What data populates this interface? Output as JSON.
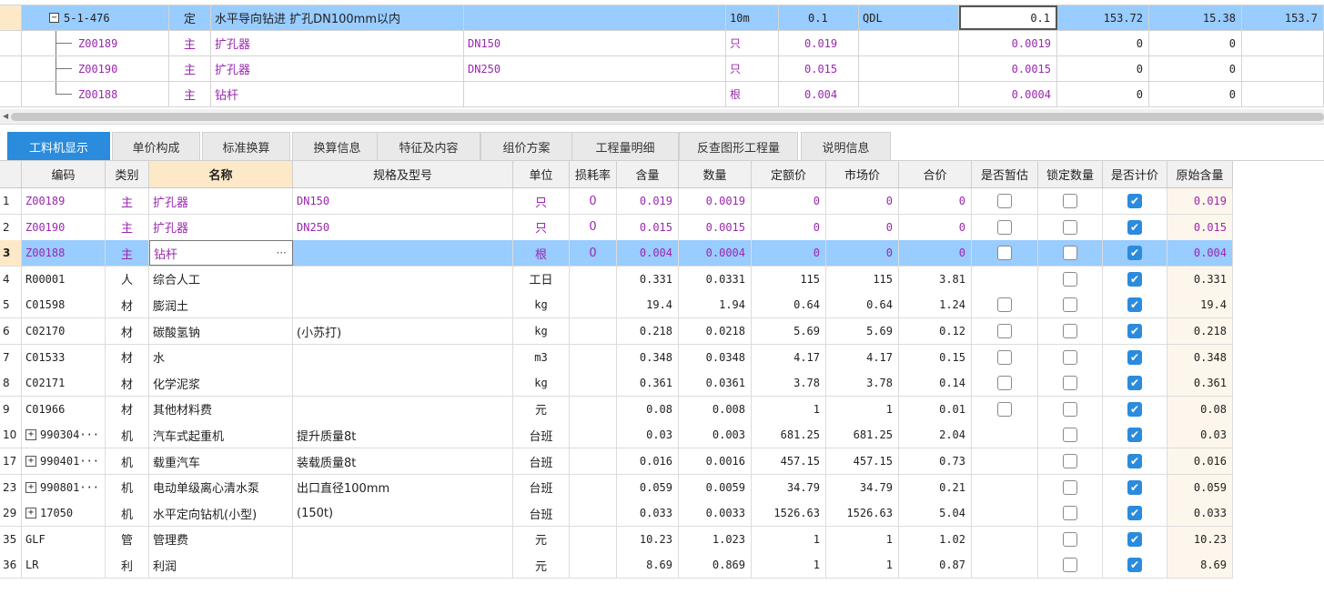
{
  "top_grid": {
    "rows": [
      {
        "code": "5-1-476",
        "type": "定",
        "name": "水平导向钻进 扩孔DN100mm以内",
        "spec": "",
        "unit": "10m",
        "content": "0.1",
        "code2": "QDL",
        "qty": "0.1",
        "v1": "153.72",
        "v2": "15.38",
        "v3": "153.7",
        "expander": "−"
      },
      {
        "code": "Z00189",
        "type": "主",
        "name": "扩孔器",
        "spec": "DN150",
        "unit": "只",
        "content": "0.019",
        "code2": "",
        "qty": "0.0019",
        "v1": "0",
        "v2": "0",
        "v3": ""
      },
      {
        "code": "Z00190",
        "type": "主",
        "name": "扩孔器",
        "spec": "DN250",
        "unit": "只",
        "content": "0.015",
        "code2": "",
        "qty": "0.0015",
        "v1": "0",
        "v2": "0",
        "v3": ""
      },
      {
        "code": "Z00188",
        "type": "主",
        "name": "钻杆",
        "spec": "",
        "unit": "根",
        "content": "0.004",
        "code2": "",
        "qty": "0.0004",
        "v1": "0",
        "v2": "0",
        "v3": ""
      }
    ]
  },
  "tabs": [
    {
      "label": "工料机显示",
      "active": true
    },
    {
      "label": "单价构成"
    },
    {
      "label": "标准换算"
    },
    {
      "label": "换算信息"
    },
    {
      "label": "特征及内容"
    },
    {
      "label": "组价方案"
    },
    {
      "label": "工程量明细"
    },
    {
      "label": "反查图形工程量"
    },
    {
      "label": "说明信息"
    }
  ],
  "detail": {
    "headers": {
      "code": "编码",
      "type": "类别",
      "name": "名称",
      "spec": "规格及型号",
      "unit": "单位",
      "loss": "损耗率",
      "content": "含量",
      "qty": "数量",
      "quota_price": "定额价",
      "market_price": "市场价",
      "total": "合价",
      "is_estimate": "是否暂估",
      "lock_qty": "锁定数量",
      "is_priced": "是否计价",
      "orig_content": "原始含量"
    },
    "rows": [
      {
        "rn": "1",
        "code": "Z00189",
        "type": "主",
        "name": "扩孔器",
        "spec": "DN150",
        "unit": "只",
        "loss": "0",
        "content": "0.019",
        "qty": "0.0019",
        "quota_price": "0",
        "market_price": "0",
        "total": "0",
        "est": false,
        "lock": false,
        "priced": true,
        "orig": "0.019",
        "purple": true
      },
      {
        "rn": "2",
        "code": "Z00190",
        "type": "主",
        "name": "扩孔器",
        "spec": "DN250",
        "unit": "只",
        "loss": "0",
        "content": "0.015",
        "qty": "0.0015",
        "quota_price": "0",
        "market_price": "0",
        "total": "0",
        "est": false,
        "lock": false,
        "priced": true,
        "orig": "0.015",
        "purple": true
      },
      {
        "rn": "3",
        "code": "Z00188",
        "type": "主",
        "name": "钻杆",
        "spec": "",
        "unit": "根",
        "loss": "0",
        "content": "0.004",
        "qty": "0.0004",
        "quota_price": "0",
        "market_price": "0",
        "total": "0",
        "est": false,
        "lock": false,
        "priced": true,
        "orig": "0.004",
        "purple": true,
        "selected": true,
        "more": "···"
      },
      {
        "rn": "4",
        "code": "R00001",
        "type": "人",
        "name": "综合人工",
        "spec": "",
        "unit": "工日",
        "loss": "",
        "content": "0.331",
        "qty": "0.0331",
        "quota_price": "115",
        "market_price": "115",
        "total": "3.81",
        "est": null,
        "lock": false,
        "priced": true,
        "orig": "0.331"
      },
      {
        "rn": "5",
        "code": "C01598",
        "type": "材",
        "name": "膨润土",
        "spec": "",
        "unit": "kg",
        "loss": "",
        "content": "19.4",
        "qty": "1.94",
        "quota_price": "0.64",
        "market_price": "0.64",
        "total": "1.24",
        "est": false,
        "lock": false,
        "priced": true,
        "orig": "19.4"
      },
      {
        "rn": "6",
        "code": "C02170",
        "type": "材",
        "name": "碳酸氢钠",
        "spec": "(小苏打)",
        "unit": "kg",
        "loss": "",
        "content": "0.218",
        "qty": "0.0218",
        "quota_price": "5.69",
        "market_price": "5.69",
        "total": "0.12",
        "est": false,
        "lock": false,
        "priced": true,
        "orig": "0.218"
      },
      {
        "rn": "7",
        "code": "C01533",
        "type": "材",
        "name": "水",
        "spec": "",
        "unit": "m3",
        "loss": "",
        "content": "0.348",
        "qty": "0.0348",
        "quota_price": "4.17",
        "market_price": "4.17",
        "total": "0.15",
        "est": false,
        "lock": false,
        "priced": true,
        "orig": "0.348"
      },
      {
        "rn": "8",
        "code": "C02171",
        "type": "材",
        "name": "化学泥浆",
        "spec": "",
        "unit": "kg",
        "loss": "",
        "content": "0.361",
        "qty": "0.0361",
        "quota_price": "3.78",
        "market_price": "3.78",
        "total": "0.14",
        "est": false,
        "lock": false,
        "priced": true,
        "orig": "0.361"
      },
      {
        "rn": "9",
        "code": "C01966",
        "type": "材",
        "name": "其他材料费",
        "spec": "",
        "unit": "元",
        "loss": "",
        "content": "0.08",
        "qty": "0.008",
        "quota_price": "1",
        "market_price": "1",
        "total": "0.01",
        "est": false,
        "lock": false,
        "priced": true,
        "orig": "0.08"
      },
      {
        "rn": "10",
        "code": "990304···",
        "type": "机",
        "name": "汽车式起重机",
        "spec": "提升质量8t",
        "unit": "台班",
        "loss": "",
        "content": "0.03",
        "qty": "0.003",
        "quota_price": "681.25",
        "market_price": "681.25",
        "total": "2.04",
        "est": null,
        "lock": false,
        "priced": true,
        "orig": "0.03",
        "plus": "+"
      },
      {
        "rn": "17",
        "code": "990401···",
        "type": "机",
        "name": "载重汽车",
        "spec": "装载质量8t",
        "unit": "台班",
        "loss": "",
        "content": "0.016",
        "qty": "0.0016",
        "quota_price": "457.15",
        "market_price": "457.15",
        "total": "0.73",
        "est": null,
        "lock": false,
        "priced": true,
        "orig": "0.016",
        "plus": "+"
      },
      {
        "rn": "23",
        "code": "990801···",
        "type": "机",
        "name": "电动单级离心清水泵",
        "spec": "出口直径100mm",
        "unit": "台班",
        "loss": "",
        "content": "0.059",
        "qty": "0.0059",
        "quota_price": "34.79",
        "market_price": "34.79",
        "total": "0.21",
        "est": null,
        "lock": false,
        "priced": true,
        "orig": "0.059",
        "plus": "+"
      },
      {
        "rn": "29",
        "code": "17050",
        "type": "机",
        "name": "水平定向钻机(小型)",
        "spec": "(150t)",
        "unit": "台班",
        "loss": "",
        "content": "0.033",
        "qty": "0.0033",
        "quota_price": "1526.63",
        "market_price": "1526.63",
        "total": "5.04",
        "est": null,
        "lock": false,
        "priced": true,
        "orig": "0.033",
        "plus": "+"
      },
      {
        "rn": "35",
        "code": "GLF",
        "type": "管",
        "name": "管理费",
        "spec": "",
        "unit": "元",
        "loss": "",
        "content": "10.23",
        "qty": "1.023",
        "quota_price": "1",
        "market_price": "1",
        "total": "1.02",
        "est": null,
        "lock": false,
        "priced": true,
        "orig": "10.23"
      },
      {
        "rn": "36",
        "code": "LR",
        "type": "利",
        "name": "利润",
        "spec": "",
        "unit": "元",
        "loss": "",
        "content": "8.69",
        "qty": "0.869",
        "quota_price": "1",
        "market_price": "1",
        "total": "0.87",
        "est": null,
        "lock": false,
        "priced": true,
        "orig": "8.69"
      }
    ]
  },
  "colors": {
    "selected_row": "#99ccff",
    "active_tab": "#2b8bdc",
    "material_text": "#9c27b0",
    "gutter_highlight": "#fde9c8"
  },
  "icons": {
    "checkbox_checked": "check-icon",
    "expand": "plus-icon",
    "collapse": "minus-icon",
    "scroll_left": "arrow-left-icon"
  }
}
